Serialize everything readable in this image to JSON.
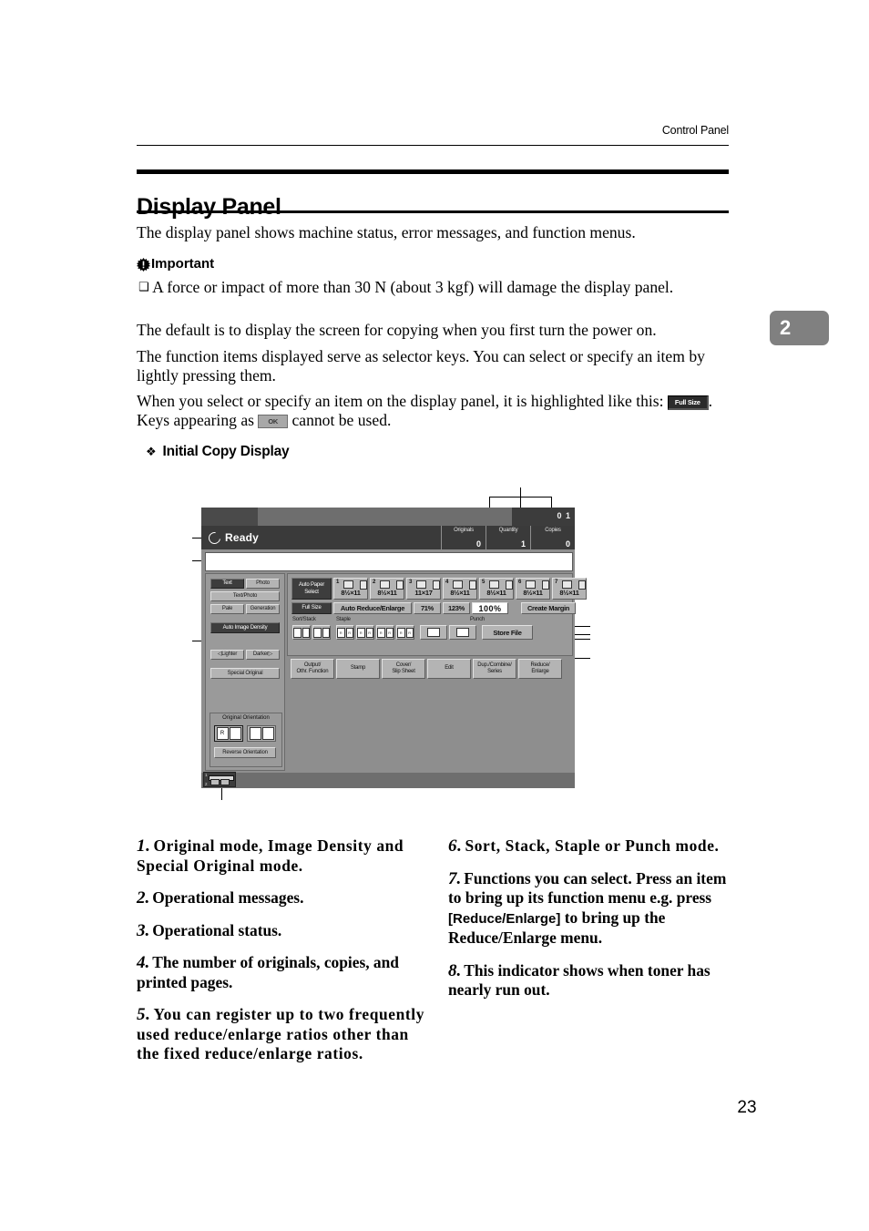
{
  "running_head": "Control Panel",
  "page_title": "Display Panel",
  "chapter_tab": "2",
  "page_number": "23",
  "body": {
    "p1": "The display panel shows machine status, error messages, and function menus.",
    "important_label": "Important",
    "bullet": "A force or impact of more than 30 N (about 3 kgf) will damage the display panel.",
    "p2": "The default is to display the screen for copying when you first turn the power on.",
    "p3": "The function items displayed serve as selector keys. You can select or specify an item by lightly pressing them.",
    "p4_a": "When you select or specify an item on the display panel, it is highlighted like this:",
    "p4_key_dark": "Full Size",
    "p4_b": ". Keys appearing as",
    "p4_key_gray": "OK",
    "p4_c": "cannot be used."
  },
  "section_heading": "Initial Copy Display",
  "lcd": {
    "counter_top": "0 1",
    "status": "Ready",
    "counters": [
      {
        "label": "Originals",
        "value": "0"
      },
      {
        "label": "Quantity",
        "value": "1"
      },
      {
        "label": "Copies",
        "value": "0"
      }
    ],
    "original_mode": {
      "text": "Text",
      "photo": "Photo",
      "text_photo": "Text/Photo",
      "pale": "Pale",
      "generation": "Generation"
    },
    "image_density": {
      "auto": "Auto Image Density",
      "lighter": "Lighter",
      "darker": "Darker"
    },
    "special_original": "Special Original",
    "orientation": {
      "label": "Original Orientation",
      "reverse": "Reverse Orientation"
    },
    "auto_paper_select": "Auto Paper Select",
    "trays": [
      {
        "num": "1",
        "size": "8½×11"
      },
      {
        "num": "2",
        "size": "8½×11"
      },
      {
        "num": "3",
        "size": "11×17"
      },
      {
        "num": "4",
        "size": "8½×11"
      },
      {
        "num": "5",
        "size": "8½×11"
      },
      {
        "num": "6",
        "size": "8½×11"
      },
      {
        "num": "7",
        "size": "8½×11"
      }
    ],
    "ratio_row": {
      "full_size": "Full Size",
      "auto_reduce": "Auto Reduce/Enlarge",
      "r1": "71%",
      "r2": "123%",
      "r3": "100%",
      "create_margin": "Create Margin"
    },
    "finisher": {
      "sort_stack": "Sort/Stack",
      "staple": "Staple",
      "punch": "Punch",
      "store_file": "Store File"
    },
    "functions": [
      "Output/\nOthr. Function",
      "Stamp",
      "Cover/\nSlip Sheet",
      "Edit",
      "Dup./Combine/\nSeries",
      "Reduce/\nEnlarge"
    ],
    "toner": {
      "l1": "1",
      "l2": "2"
    }
  },
  "legend": {
    "left": [
      {
        "num": "1.",
        "text": "Original mode, Image Density and Special Original mode."
      },
      {
        "num": "2.",
        "text": "Operational messages."
      },
      {
        "num": "3.",
        "text": "Operational status."
      },
      {
        "num": "4.",
        "text": "The number of originals, copies, and printed pages."
      },
      {
        "num": "5.",
        "text": "You can register up to two frequently used reduce/enlarge ratios other than the fixed reduce/enlarge ratios."
      }
    ],
    "right": [
      {
        "num": "6.",
        "text": "Sort, Stack, Staple or Punch mode."
      },
      {
        "num": "7.",
        "a": "Functions you can select. Press an item to bring up its function menu e.g. press",
        "key": "[Reduce/Enlarge]",
        "b": "to bring up the Reduce/Enlarge menu."
      },
      {
        "num": "8.",
        "text": "This indicator shows when toner has nearly run out."
      }
    ]
  }
}
